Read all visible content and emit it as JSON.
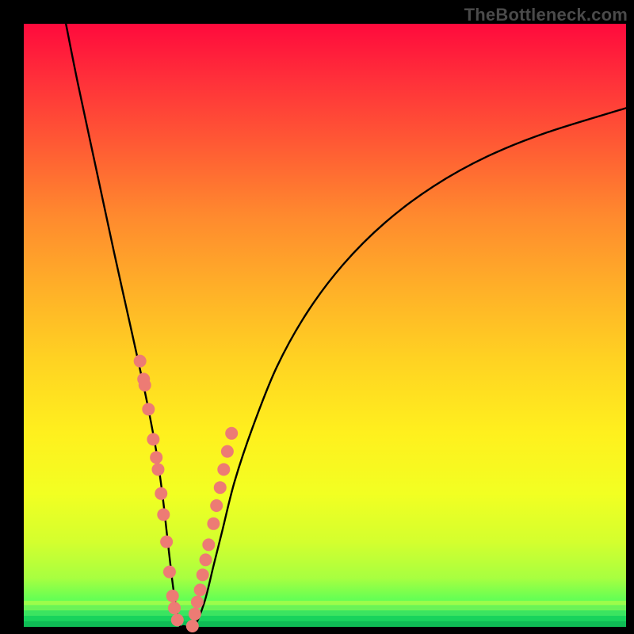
{
  "watermark": "TheBottleneck.com",
  "chart_data": {
    "type": "line",
    "title": "",
    "xlabel": "",
    "ylabel": "",
    "xlim": [
      0,
      100
    ],
    "ylim": [
      0,
      100
    ],
    "curve": {
      "x": [
        7,
        9,
        12,
        15,
        17,
        19,
        20.5,
        22,
        23,
        23.8,
        24.6,
        25.3,
        25.9,
        26.5,
        28.3,
        30,
        31.5,
        33,
        35,
        38,
        42,
        47,
        53,
        60,
        68,
        77,
        87,
        100
      ],
      "y": [
        100,
        90,
        76,
        62,
        53,
        44,
        37,
        29,
        22,
        15,
        8,
        3,
        0,
        0,
        0,
        4,
        10,
        16,
        24,
        33,
        43,
        52,
        60,
        67,
        73,
        78,
        82,
        86
      ]
    },
    "dots_left": {
      "x": [
        19.3,
        19.9,
        20.1,
        20.7,
        21.5,
        22.0,
        22.3,
        22.8,
        23.2,
        23.7,
        24.2,
        24.7,
        25.0,
        25.5
      ],
      "y": [
        44.0,
        41.0,
        40.0,
        36.0,
        31.0,
        28.0,
        26.0,
        22.0,
        18.5,
        14.0,
        9.0,
        5.0,
        3.0,
        1.0
      ]
    },
    "dots_right": {
      "x": [
        28.0,
        28.4,
        28.8,
        29.3,
        29.7,
        30.2,
        30.7,
        31.5,
        32.0,
        32.6,
        33.2,
        33.8,
        34.5
      ],
      "y": [
        0.0,
        2.0,
        4.0,
        6.0,
        8.5,
        11.0,
        13.5,
        17.0,
        20.0,
        23.0,
        26.0,
        29.0,
        32.0
      ]
    },
    "dot_color": "#ed7b74",
    "dot_radius": 8,
    "stripes": [
      {
        "y": 95.8,
        "h": 0.6,
        "color": "#9cfc4b"
      },
      {
        "y": 96.6,
        "h": 0.7,
        "color": "#6bf357"
      },
      {
        "y": 97.4,
        "h": 0.8,
        "color": "#3be460"
      },
      {
        "y": 98.3,
        "h": 0.9,
        "color": "#18d35c"
      },
      {
        "y": 99.2,
        "h": 0.8,
        "color": "#0fbd55"
      }
    ]
  }
}
